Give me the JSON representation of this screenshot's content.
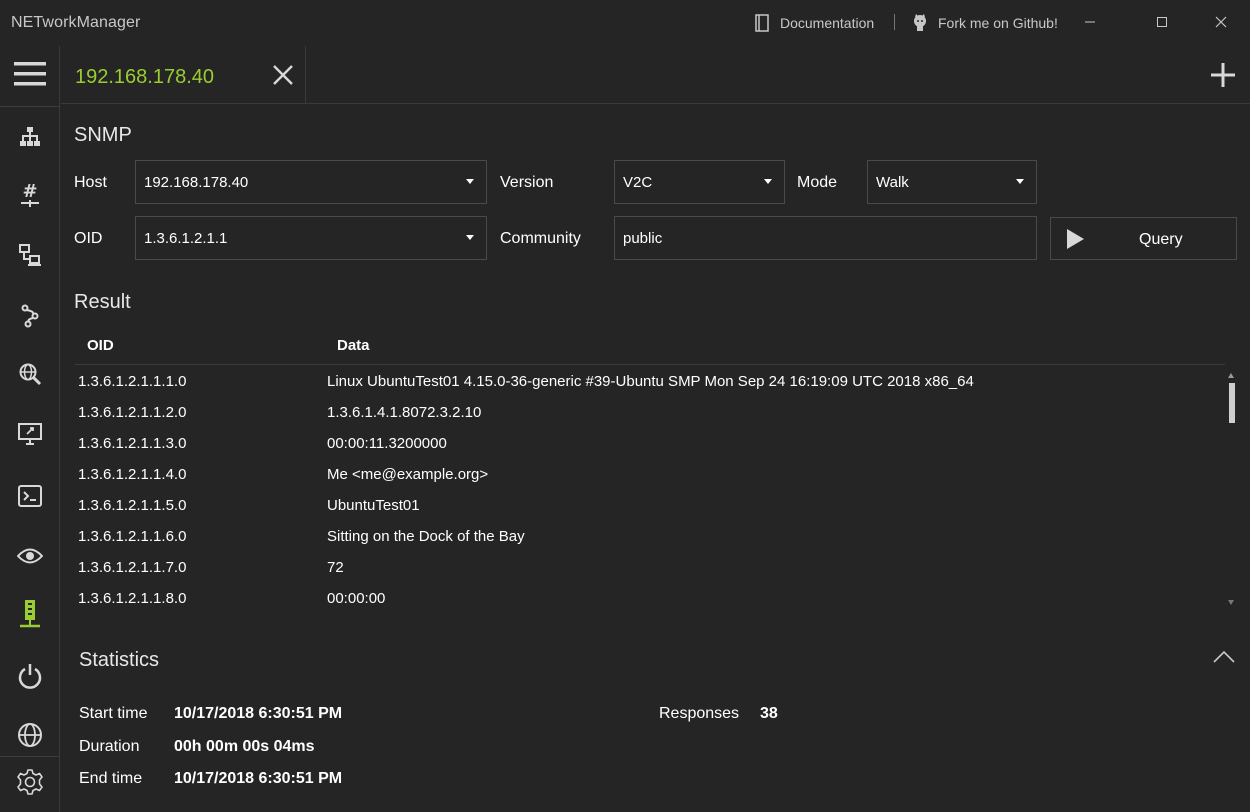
{
  "app": {
    "title": "NETworkManager",
    "documentation_label": "Documentation",
    "github_label": "Fork me on Github!"
  },
  "tab": {
    "label": "192.168.178.40"
  },
  "snmp": {
    "title": "SNMP",
    "host_label": "Host",
    "host_value": "192.168.178.40",
    "version_label": "Version",
    "version_value": "V2C",
    "mode_label": "Mode",
    "mode_value": "Walk",
    "oid_label": "OID",
    "oid_value": "1.3.6.1.2.1.1",
    "community_label": "Community",
    "community_value": "public",
    "query_label": "Query"
  },
  "result": {
    "title": "Result",
    "columns": [
      "OID",
      "Data"
    ],
    "rows": [
      {
        "oid": "1.3.6.1.2.1.1.1.0",
        "data": "Linux UbuntuTest01 4.15.0-36-generic #39-Ubuntu SMP Mon Sep 24 16:19:09 UTC 2018 x86_64"
      },
      {
        "oid": "1.3.6.1.2.1.1.2.0",
        "data": "1.3.6.1.4.1.8072.3.2.10"
      },
      {
        "oid": "1.3.6.1.2.1.1.3.0",
        "data": "00:00:11.3200000"
      },
      {
        "oid": "1.3.6.1.2.1.1.4.0",
        "data": "Me <me@example.org>"
      },
      {
        "oid": "1.3.6.1.2.1.1.5.0",
        "data": "UbuntuTest01"
      },
      {
        "oid": "1.3.6.1.2.1.1.6.0",
        "data": "Sitting on the Dock of the Bay"
      },
      {
        "oid": "1.3.6.1.2.1.1.7.0",
        "data": "72"
      },
      {
        "oid": "1.3.6.1.2.1.1.8.0",
        "data": "00:00:00"
      }
    ]
  },
  "statistics": {
    "title": "Statistics",
    "start_time_label": "Start time",
    "start_time_value": "10/17/2018 6:30:51 PM",
    "duration_label": "Duration",
    "duration_value": "00h 00m 00s 04ms",
    "end_time_label": "End time",
    "end_time_value": "10/17/2018 6:30:51 PM",
    "responses_label": "Responses",
    "responses_value": "38"
  },
  "nav": {
    "items": [
      "hamburger-menu-icon",
      "network-tree-icon",
      "ip-scanner-icon",
      "port-computers-icon",
      "traceroute-icon",
      "dns-lookup-icon",
      "remote-desktop-icon",
      "terminal-icon",
      "eye-icon",
      "snmp-server-icon",
      "power-icon",
      "globe-icon",
      "settings-gear-icon"
    ]
  },
  "colors": {
    "accent": "#9acd32",
    "background": "#252525",
    "border": "#4a4a4a"
  }
}
